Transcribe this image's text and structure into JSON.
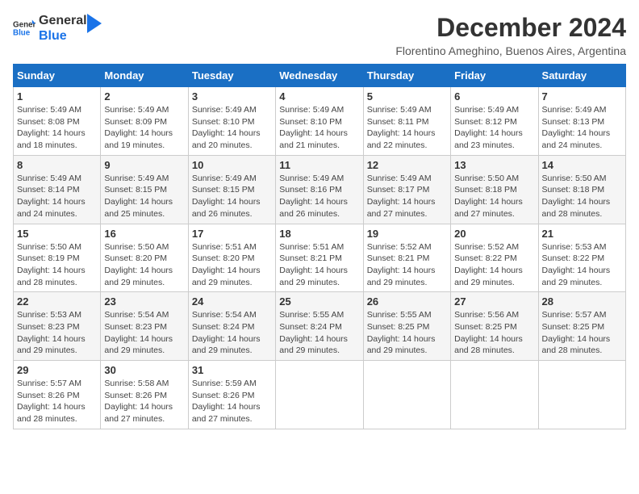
{
  "logo": {
    "line1": "General",
    "line2": "Blue"
  },
  "title": "December 2024",
  "subtitle": "Florentino Ameghino, Buenos Aires, Argentina",
  "weekdays": [
    "Sunday",
    "Monday",
    "Tuesday",
    "Wednesday",
    "Thursday",
    "Friday",
    "Saturday"
  ],
  "weeks": [
    [
      {
        "day": "1",
        "sunrise": "Sunrise: 5:49 AM",
        "sunset": "Sunset: 8:08 PM",
        "daylight": "Daylight: 14 hours and 18 minutes."
      },
      {
        "day": "2",
        "sunrise": "Sunrise: 5:49 AM",
        "sunset": "Sunset: 8:09 PM",
        "daylight": "Daylight: 14 hours and 19 minutes."
      },
      {
        "day": "3",
        "sunrise": "Sunrise: 5:49 AM",
        "sunset": "Sunset: 8:10 PM",
        "daylight": "Daylight: 14 hours and 20 minutes."
      },
      {
        "day": "4",
        "sunrise": "Sunrise: 5:49 AM",
        "sunset": "Sunset: 8:10 PM",
        "daylight": "Daylight: 14 hours and 21 minutes."
      },
      {
        "day": "5",
        "sunrise": "Sunrise: 5:49 AM",
        "sunset": "Sunset: 8:11 PM",
        "daylight": "Daylight: 14 hours and 22 minutes."
      },
      {
        "day": "6",
        "sunrise": "Sunrise: 5:49 AM",
        "sunset": "Sunset: 8:12 PM",
        "daylight": "Daylight: 14 hours and 23 minutes."
      },
      {
        "day": "7",
        "sunrise": "Sunrise: 5:49 AM",
        "sunset": "Sunset: 8:13 PM",
        "daylight": "Daylight: 14 hours and 24 minutes."
      }
    ],
    [
      {
        "day": "8",
        "sunrise": "Sunrise: 5:49 AM",
        "sunset": "Sunset: 8:14 PM",
        "daylight": "Daylight: 14 hours and 24 minutes."
      },
      {
        "day": "9",
        "sunrise": "Sunrise: 5:49 AM",
        "sunset": "Sunset: 8:15 PM",
        "daylight": "Daylight: 14 hours and 25 minutes."
      },
      {
        "day": "10",
        "sunrise": "Sunrise: 5:49 AM",
        "sunset": "Sunset: 8:15 PM",
        "daylight": "Daylight: 14 hours and 26 minutes."
      },
      {
        "day": "11",
        "sunrise": "Sunrise: 5:49 AM",
        "sunset": "Sunset: 8:16 PM",
        "daylight": "Daylight: 14 hours and 26 minutes."
      },
      {
        "day": "12",
        "sunrise": "Sunrise: 5:49 AM",
        "sunset": "Sunset: 8:17 PM",
        "daylight": "Daylight: 14 hours and 27 minutes."
      },
      {
        "day": "13",
        "sunrise": "Sunrise: 5:50 AM",
        "sunset": "Sunset: 8:18 PM",
        "daylight": "Daylight: 14 hours and 27 minutes."
      },
      {
        "day": "14",
        "sunrise": "Sunrise: 5:50 AM",
        "sunset": "Sunset: 8:18 PM",
        "daylight": "Daylight: 14 hours and 28 minutes."
      }
    ],
    [
      {
        "day": "15",
        "sunrise": "Sunrise: 5:50 AM",
        "sunset": "Sunset: 8:19 PM",
        "daylight": "Daylight: 14 hours and 28 minutes."
      },
      {
        "day": "16",
        "sunrise": "Sunrise: 5:50 AM",
        "sunset": "Sunset: 8:20 PM",
        "daylight": "Daylight: 14 hours and 29 minutes."
      },
      {
        "day": "17",
        "sunrise": "Sunrise: 5:51 AM",
        "sunset": "Sunset: 8:20 PM",
        "daylight": "Daylight: 14 hours and 29 minutes."
      },
      {
        "day": "18",
        "sunrise": "Sunrise: 5:51 AM",
        "sunset": "Sunset: 8:21 PM",
        "daylight": "Daylight: 14 hours and 29 minutes."
      },
      {
        "day": "19",
        "sunrise": "Sunrise: 5:52 AM",
        "sunset": "Sunset: 8:21 PM",
        "daylight": "Daylight: 14 hours and 29 minutes."
      },
      {
        "day": "20",
        "sunrise": "Sunrise: 5:52 AM",
        "sunset": "Sunset: 8:22 PM",
        "daylight": "Daylight: 14 hours and 29 minutes."
      },
      {
        "day": "21",
        "sunrise": "Sunrise: 5:53 AM",
        "sunset": "Sunset: 8:22 PM",
        "daylight": "Daylight: 14 hours and 29 minutes."
      }
    ],
    [
      {
        "day": "22",
        "sunrise": "Sunrise: 5:53 AM",
        "sunset": "Sunset: 8:23 PM",
        "daylight": "Daylight: 14 hours and 29 minutes."
      },
      {
        "day": "23",
        "sunrise": "Sunrise: 5:54 AM",
        "sunset": "Sunset: 8:23 PM",
        "daylight": "Daylight: 14 hours and 29 minutes."
      },
      {
        "day": "24",
        "sunrise": "Sunrise: 5:54 AM",
        "sunset": "Sunset: 8:24 PM",
        "daylight": "Daylight: 14 hours and 29 minutes."
      },
      {
        "day": "25",
        "sunrise": "Sunrise: 5:55 AM",
        "sunset": "Sunset: 8:24 PM",
        "daylight": "Daylight: 14 hours and 29 minutes."
      },
      {
        "day": "26",
        "sunrise": "Sunrise: 5:55 AM",
        "sunset": "Sunset: 8:25 PM",
        "daylight": "Daylight: 14 hours and 29 minutes."
      },
      {
        "day": "27",
        "sunrise": "Sunrise: 5:56 AM",
        "sunset": "Sunset: 8:25 PM",
        "daylight": "Daylight: 14 hours and 28 minutes."
      },
      {
        "day": "28",
        "sunrise": "Sunrise: 5:57 AM",
        "sunset": "Sunset: 8:25 PM",
        "daylight": "Daylight: 14 hours and 28 minutes."
      }
    ],
    [
      {
        "day": "29",
        "sunrise": "Sunrise: 5:57 AM",
        "sunset": "Sunset: 8:26 PM",
        "daylight": "Daylight: 14 hours and 28 minutes."
      },
      {
        "day": "30",
        "sunrise": "Sunrise: 5:58 AM",
        "sunset": "Sunset: 8:26 PM",
        "daylight": "Daylight: 14 hours and 27 minutes."
      },
      {
        "day": "31",
        "sunrise": "Sunrise: 5:59 AM",
        "sunset": "Sunset: 8:26 PM",
        "daylight": "Daylight: 14 hours and 27 minutes."
      },
      null,
      null,
      null,
      null
    ]
  ],
  "colors": {
    "header_bg": "#1a6fc4",
    "header_text": "#ffffff",
    "accent_blue": "#1a73e8"
  }
}
